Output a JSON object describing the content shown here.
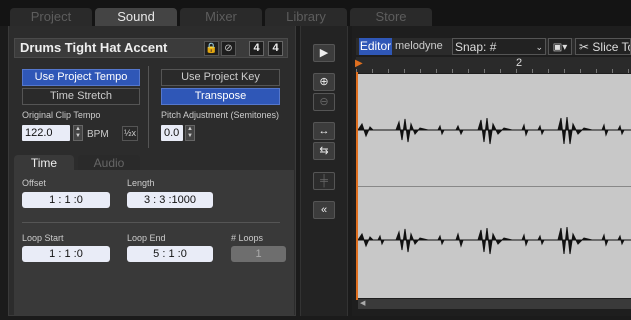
{
  "tabs": [
    "Project",
    "Sound",
    "Mixer",
    "Library",
    "Store"
  ],
  "clip": {
    "title": "Drums Tight Hat Accent",
    "time_sig_num": "4",
    "time_sig_den": "4"
  },
  "tempo": {
    "use_project_tempo": "Use Project Tempo",
    "time_stretch": "Time Stretch",
    "original_clip_tempo_label": "Original Clip Tempo",
    "bpm_value": "122.0",
    "bpm_unit": "BPM",
    "half_label": "½x"
  },
  "key": {
    "use_project_key": "Use Project Key",
    "transpose": "Transpose",
    "pitch_label": "Pitch Adjustment (Semitones)",
    "pitch_value": "0.0"
  },
  "subtabs": [
    "Time",
    "Audio"
  ],
  "timing": {
    "offset_label": "Offset",
    "offset_value": "1 :  1  :0",
    "length_label": "Length",
    "length_value": "3 :  3  :1000",
    "loop_start_label": "Loop Start",
    "loop_start_value": "1 :  1  :0",
    "loop_end_label": "Loop End",
    "loop_end_value": "5 :  1  :0",
    "loops_label": "# Loops",
    "loops_value": "1"
  },
  "editor": {
    "editor_label": "Editor",
    "melodyne_label": "melodyne",
    "snap_label": "Snap:",
    "slice_label": "Slice To",
    "ruler_mark": "2"
  },
  "colors": {
    "accent_blue": "#2f57b7",
    "playhead_orange": "#e07020"
  }
}
